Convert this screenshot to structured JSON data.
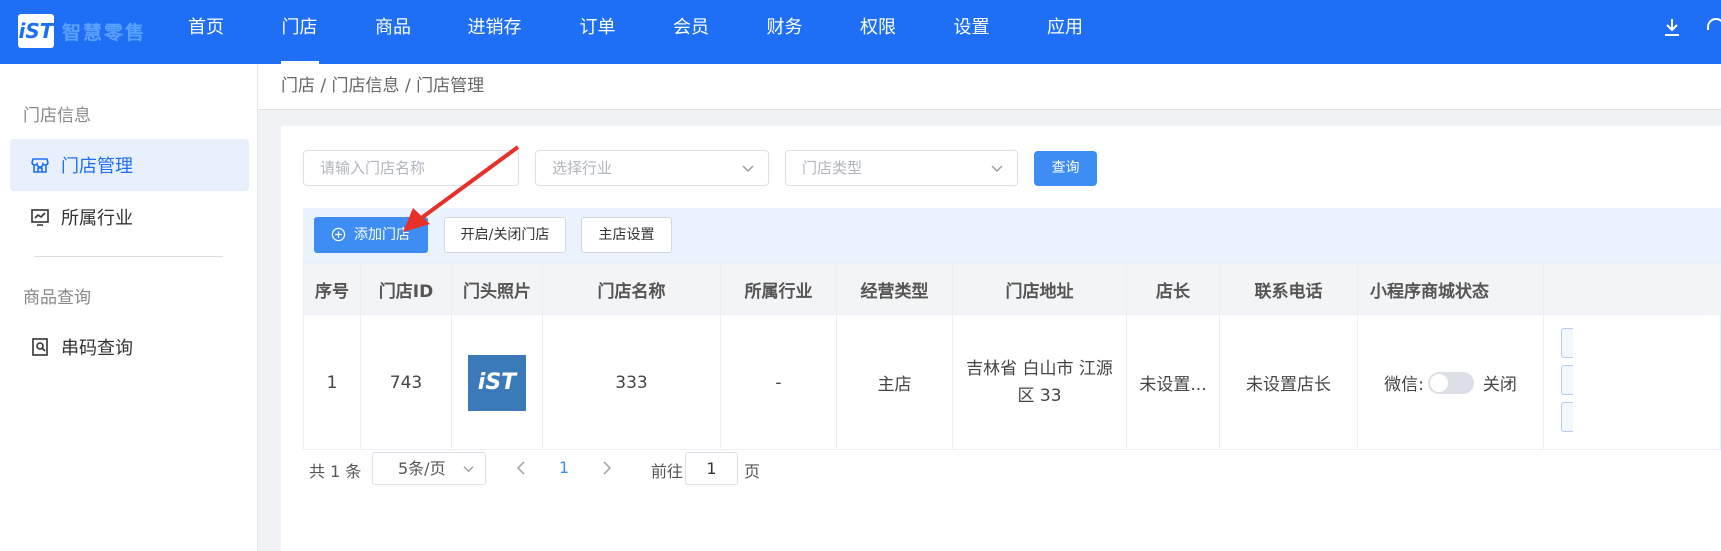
{
  "brand": {
    "logo_mark": "iST",
    "name": "智慧零售"
  },
  "nav": {
    "items": [
      {
        "label": "首页"
      },
      {
        "label": "门店",
        "active": true
      },
      {
        "label": "商品"
      },
      {
        "label": "进销存"
      },
      {
        "label": "订单"
      },
      {
        "label": "会员"
      },
      {
        "label": "财务"
      },
      {
        "label": "权限"
      },
      {
        "label": "设置"
      },
      {
        "label": "应用"
      }
    ],
    "right_icons": [
      "download-icon",
      "headset-icon"
    ]
  },
  "sidebar": {
    "group1": "门店信息",
    "items": [
      {
        "label": "门店管理",
        "icon": "store-icon",
        "active": true
      },
      {
        "label": "所属行业",
        "icon": "chart-icon"
      }
    ],
    "group2": "商品查询",
    "items2": [
      {
        "label": "串码查询",
        "icon": "search-doc-icon"
      }
    ]
  },
  "breadcrumb": "门店 / 门店信息 / 门店管理",
  "filters": {
    "name_placeholder": "请输入门店名称",
    "industry_placeholder": "选择行业",
    "type_placeholder": "门店类型",
    "query_label": "查询"
  },
  "toolbar": {
    "add_label": "添加门店",
    "toggle_label": "开启/关闭门店",
    "main_store_label": "主店设置"
  },
  "table": {
    "columns": [
      "序号",
      "门店ID",
      "门头照片",
      "门店名称",
      "所属行业",
      "经营类型",
      "门店地址",
      "店长",
      "联系电话",
      "小程序商城状态"
    ],
    "rows": [
      {
        "index": "1",
        "store_id": "743",
        "photo_mark": "iST",
        "name": "333",
        "industry": "-",
        "biz_type": "主店",
        "address": "吉林省 白山市 江源区 33",
        "manager": "未设置...",
        "phone": "未设置店长",
        "mini_label": "微信:",
        "mini_status": "关闭"
      }
    ]
  },
  "pagination": {
    "total": "共 1 条",
    "page_size": "5条/页",
    "current": "1",
    "goto_label": "前往",
    "goto_value": "1",
    "unit": "页"
  },
  "colors": {
    "primary": "#1e6ff5",
    "button": "#3d8df5",
    "annotation_arrow": "#e8302a"
  }
}
